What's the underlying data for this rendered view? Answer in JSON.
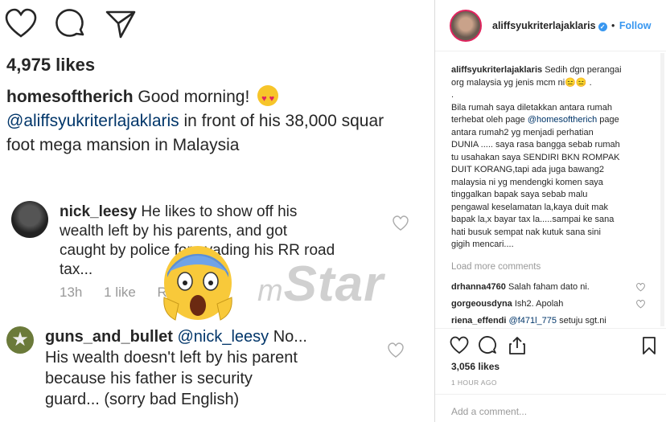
{
  "zoomed_post": {
    "likes": "4,975 likes",
    "caption": {
      "user": "homesoftherich",
      "line1": "Good morning!",
      "mention": "@aliffsyukriterlajaklaris",
      "line2_rest": "in front of his 38,000 squar",
      "line3": "foot mega mansion in Malaysia"
    },
    "comment1": {
      "user": "nick_leesy",
      "line1": "He likes to show off his",
      "line2": "wealth left by his parents, and got",
      "line3": "caught by police for evading his RR road",
      "line4": "tax...",
      "time": "13h",
      "likes": "1 like",
      "reply": "Re"
    },
    "comment2": {
      "user": "guns_and_bullet",
      "mention": "@nick_leesy",
      "line1_rest": "No...",
      "line2": "His wealth doesn't left by his parent",
      "line3": "because his father is security",
      "line4": "guard... (sorry bad English)"
    },
    "watermark": {
      "prefix": "m",
      "main": "Star"
    }
  },
  "post_panel": {
    "header": {
      "username": "aliffsyukriterlajaklaris",
      "verified_icon": "check",
      "separator": "•",
      "follow_label": "Follow"
    },
    "caption": {
      "user": "aliffsyukriterlajaklaris",
      "line1_rest": "Sedih dgn perangai",
      "line2": "org malaysia yg jenis mcm ni😑😑 .",
      "line3": ".",
      "line4": "Bila rumah saya diletakkan antara rumah",
      "line5_pre": "terhebat oleh page",
      "line5_mention": "@homesoftherich",
      "line5_post": "page",
      "line6": "antara rumah2 yg menjadi perhatian",
      "line7": "DUNIA ..... saya rasa bangga sebab rumah",
      "line8": "tu usahakan saya SENDIRI BKN ROMPAK",
      "line9": "DUIT KORANG,tapi ada juga bawang2",
      "line10": "malaysia ni yg mendengki komen saya",
      "line11": "tinggalkan bapak saya sebab malu",
      "line12": "pengawal keselamatan la,kaya duit mak",
      "line13": "bapak la,x bayar tax la.....sampai ke sana",
      "line14": "hati busuk sempat nak kutuk sana sini",
      "line15": "gigih mencari...."
    },
    "load_more": "Load more comments",
    "comments": [
      {
        "user": "drhanna4760",
        "text": "Salah faham dato ni."
      },
      {
        "user": "gorgeousdyna",
        "text": "Ish2. Apolah"
      },
      {
        "user": "riena_effendi",
        "mention": "@f471l_775",
        "text": "setuju sgt.ni"
      }
    ],
    "likes": "3,056 likes",
    "time": "1 HOUR AGO",
    "add_comment_placeholder": "Add a comment..."
  }
}
